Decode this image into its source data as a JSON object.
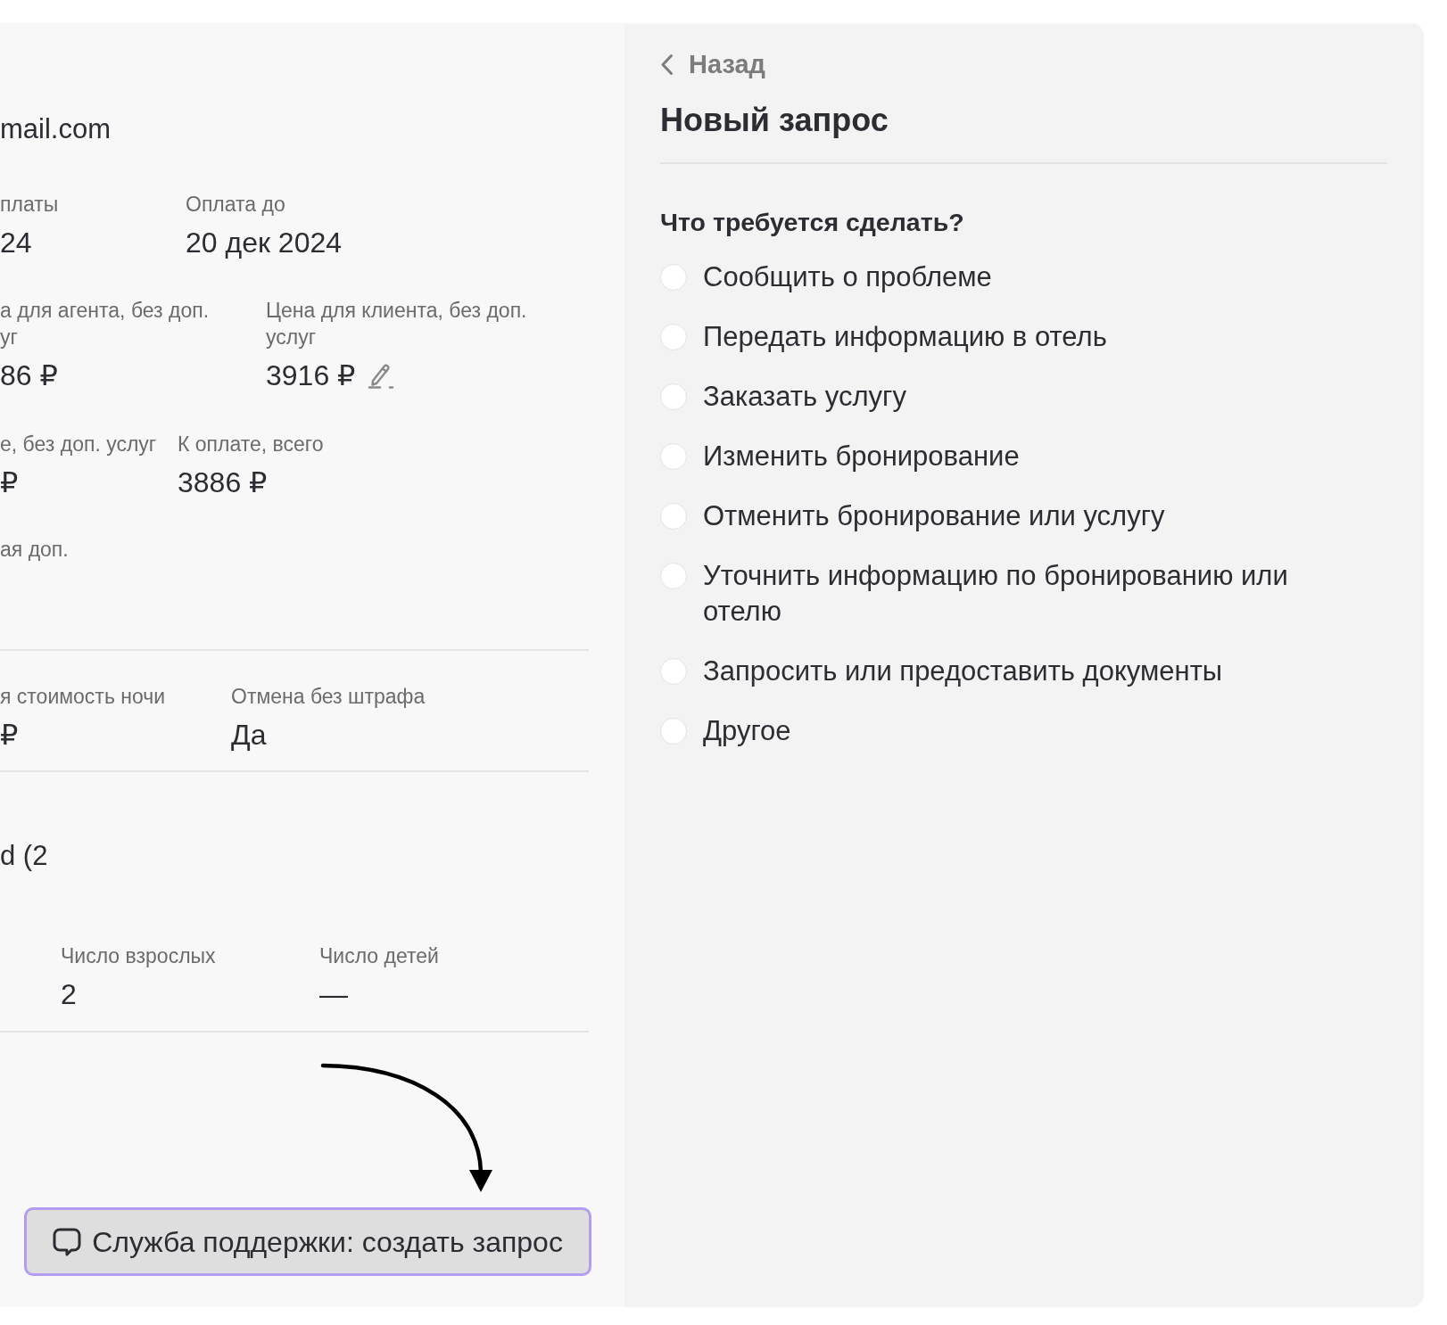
{
  "details": {
    "sections": [
      {
        "items": [
          {
            "kind": "value_text",
            "text": "mail.com"
          },
          {
            "kind": "fields",
            "fields": [
              {
                "label_lines": [
                  "платы"
                ],
                "value": "24",
                "editable": false
              },
              {
                "label_lines": [
                  "Оплата до"
                ],
                "value": "20 дек 2024",
                "editable": false
              }
            ]
          },
          {
            "kind": "fields",
            "fields": [
              {
                "label_lines": [
                  "а для агента, без доп.",
                  "уг"
                ],
                "value": "86 ₽",
                "editable": false
              },
              {
                "label_lines": [
                  "Цена для клиента, без доп. услуг"
                ],
                "value": "3916 ₽",
                "editable": true
              }
            ]
          },
          {
            "kind": "fields",
            "fields": [
              {
                "label_lines": [
                  "е, без доп. услуг"
                ],
                "value": "₽",
                "editable": false
              },
              {
                "label_lines": [
                  "К оплате, всего"
                ],
                "value": "3886 ₽",
                "editable": false
              }
            ]
          },
          {
            "kind": "label_text",
            "text": "ая доп."
          }
        ]
      },
      {
        "items": [
          {
            "kind": "fields",
            "fields": [
              {
                "label_lines": [
                  "я стоимость ночи"
                ],
                "value": "₽",
                "editable": false
              },
              {
                "label_lines": [
                  "Отмена без штрафа"
                ],
                "value": "Да",
                "editable": false
              }
            ]
          }
        ]
      },
      {
        "items": [
          {
            "kind": "value_text",
            "text": "d (2"
          },
          {
            "kind": "fields",
            "fields": [
              {
                "label_lines": [
                  "Число взрослых"
                ],
                "value": "2",
                "editable": false
              },
              {
                "label_lines": [
                  "Число детей"
                ],
                "value": "—",
                "editable": false
              }
            ]
          }
        ]
      }
    ],
    "support_button": {
      "label": "Служба поддержки: создать запрос",
      "highlighted": true
    }
  },
  "request_panel": {
    "back_link": "Назад",
    "title": "Новый запрос",
    "question": "Что требуется сделать?",
    "options": [
      {
        "label": "Сообщить о проблеме",
        "selected": false
      },
      {
        "label": "Передать информацию в отель",
        "selected": false
      },
      {
        "label": "Заказать услугу",
        "selected": false
      },
      {
        "label": "Изменить бронирование",
        "selected": false
      },
      {
        "label": "Отменить бронирование или услугу",
        "selected": false
      },
      {
        "label": "Уточнить информацию по бронированию или отелю",
        "selected": false
      },
      {
        "label": "Запросить или предоставить документы",
        "selected": false
      },
      {
        "label": "Другое",
        "selected": false
      }
    ]
  }
}
